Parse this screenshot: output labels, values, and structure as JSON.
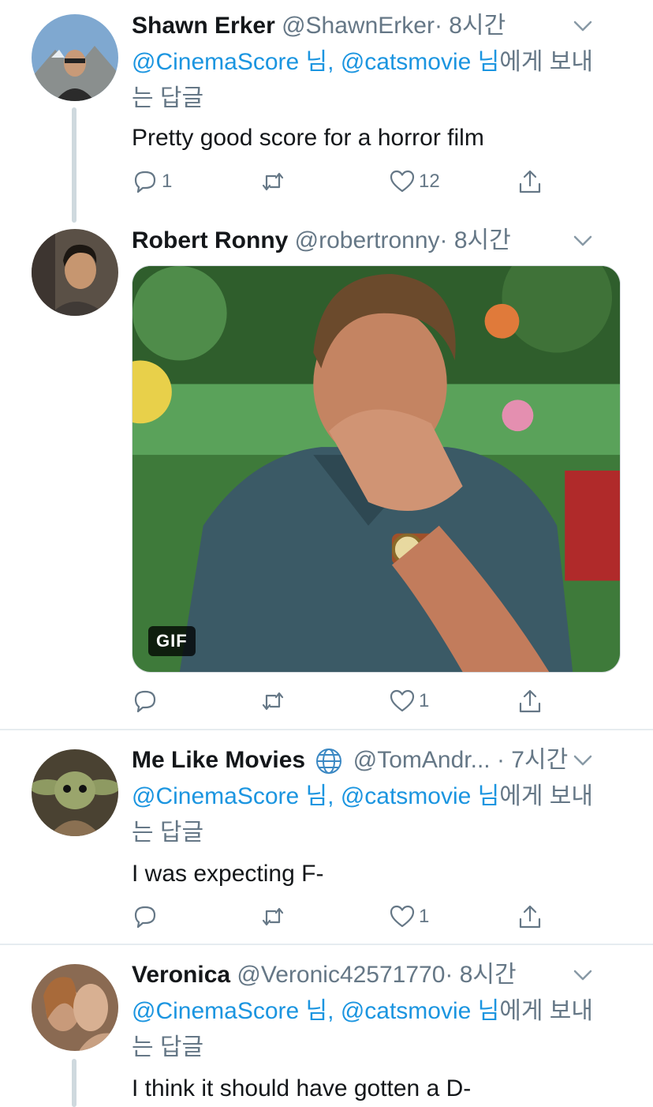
{
  "tweets": [
    {
      "name": "Shawn Erker",
      "handle": "@ShawnErker",
      "time": "· 8시간",
      "reply_mention_1": "@CinemaScore 님,",
      "reply_mention_2": "@catsmovie 님",
      "reply_suffix_1": "에게 보내",
      "reply_suffix_2": "는 답글",
      "text": "Pretty good score for a horror film",
      "replies": "1",
      "retweets": "",
      "likes": "12"
    },
    {
      "name": "Robert Ronny",
      "handle": "@robertronny",
      "time": "· 8시간",
      "media_badge": "GIF",
      "replies": "",
      "retweets": "",
      "likes": "1"
    },
    {
      "name": "Me Like Movies",
      "handle": "@TomAndr...",
      "time": "· 7시간",
      "reply_mention_1": "@CinemaScore 님,",
      "reply_mention_2": "@catsmovie 님",
      "reply_suffix_1": "에게 보내",
      "reply_suffix_2": "는 답글",
      "text": "I was expecting F-",
      "replies": "",
      "retweets": "",
      "likes": "1"
    },
    {
      "name": "Veronica",
      "handle": "@Veronic42571770",
      "time": "· 8시간",
      "reply_mention_1": "@CinemaScore 님,",
      "reply_mention_2": "@catsmovie 님",
      "reply_suffix_1": "에게 보내",
      "reply_suffix_2": "는 답글",
      "text": "I think it should have gotten a D-"
    }
  ],
  "icons": {
    "reply": "reply-icon",
    "retweet": "retweet-icon",
    "like": "heart-icon",
    "share": "share-icon",
    "caret": "chevron-down-icon",
    "globe": "globe-icon"
  },
  "colors": {
    "link": "#1b95e0",
    "secondary_text": "#657786",
    "thread_line": "#cfd9de",
    "divider": "#e6ecf0"
  }
}
